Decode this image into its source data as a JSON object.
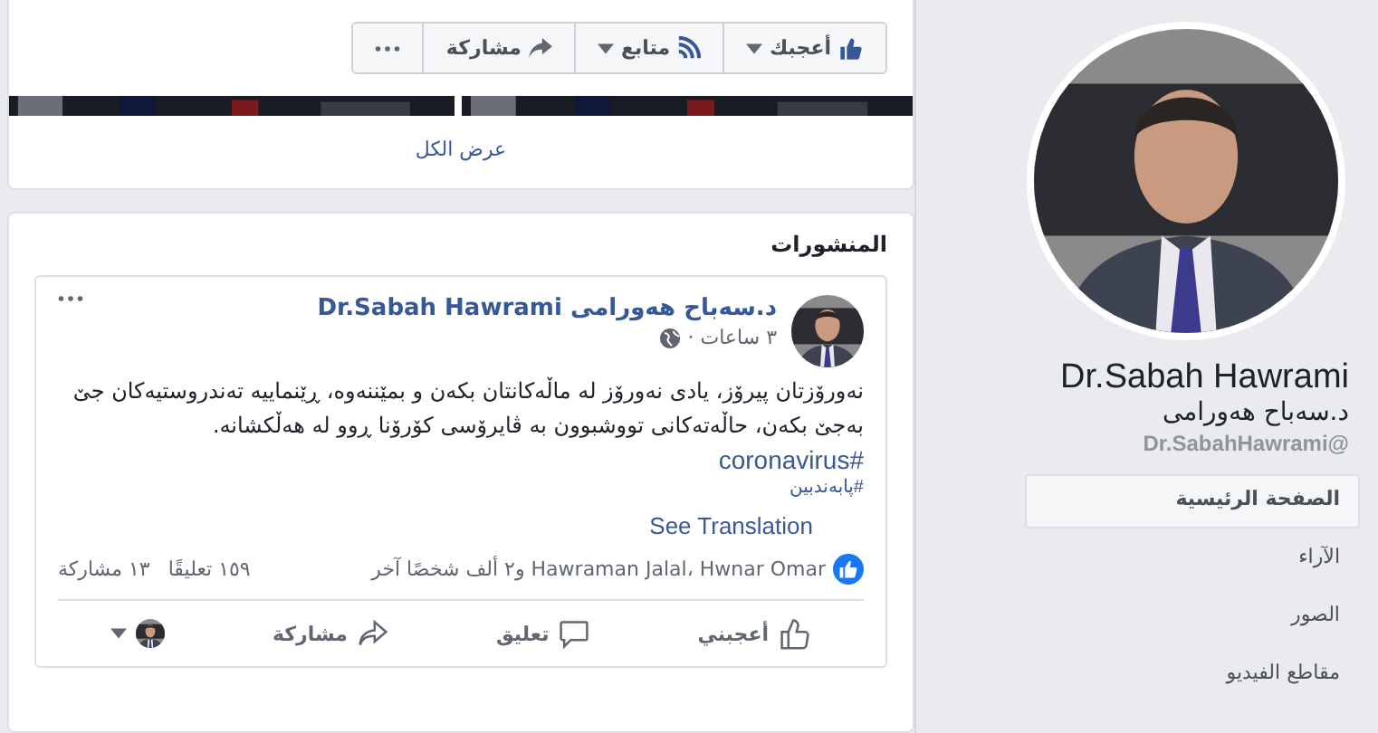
{
  "page_actions": [
    {
      "kind": "like",
      "label": "أعجبك",
      "dropdown": true
    },
    {
      "kind": "follow",
      "label": "متابع",
      "dropdown": true
    },
    {
      "kind": "share",
      "label": "مشاركة",
      "dropdown": false
    },
    {
      "kind": "more",
      "dropdown": false
    }
  ],
  "photos": {
    "link": "عرض الكل"
  },
  "posts": {
    "title": "المنشورات",
    "post": {
      "author_ku": "د.سەباح هەورامی",
      "author_en": "Dr.Sabah Hawrami",
      "time": "٣ ساعات ·",
      "body": "نەورۆزتان پیرۆز، یادی نەورۆز لە ماڵەکانتان بکەن و بمێننەوە، ڕێنماییە تەندروستیەکان جێ بەجێ بکەن، حاڵەتەکانی تووشبوون بە ڤایرۆسی کۆرۆنا ڕوو لە هەڵکشانە.",
      "hashtags": [
        {
          "text": "#coronavirus",
          "kind": "large"
        },
        {
          "text": "#پابەندبین",
          "kind": "small"
        }
      ],
      "see_translation": "See Translation",
      "reactions": "Hawraman Jalal، Hwnar Omar و٢ ألف شخصًا آخر",
      "comments": "١٥٩ تعليقًا",
      "shares": "١٣ مشاركة",
      "actions": [
        {
          "kind": "like",
          "label": "أعجبني"
        },
        {
          "kind": "comment",
          "label": "تعليق"
        },
        {
          "kind": "share",
          "label": "مشاركة"
        },
        {
          "kind": "audience"
        }
      ]
    }
  },
  "profile": {
    "name_en": "Dr.Sabah Hawrami",
    "name_ku": "د.سەباح هەورامی",
    "handle": "@Dr.SabahHawrami",
    "nav": [
      {
        "label": "الصفحة الرئيسية",
        "selected": true
      },
      {
        "label": "الآراء",
        "selected": false
      },
      {
        "label": "الصور",
        "selected": false
      },
      {
        "label": "مقاطع الفيديو",
        "selected": false
      }
    ]
  }
}
